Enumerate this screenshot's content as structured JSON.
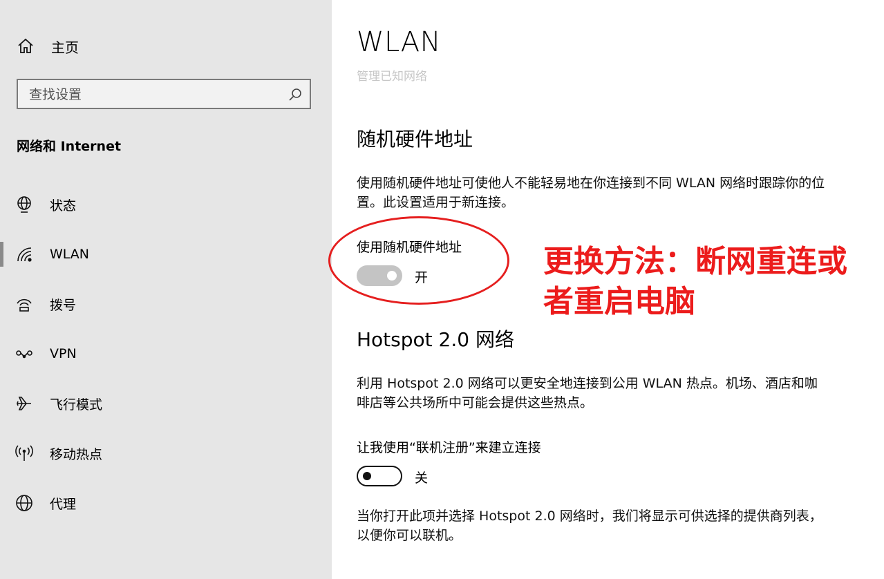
{
  "sidebar": {
    "home_label": "主页",
    "search_placeholder": "查找设置",
    "section_title": "网络和 Internet",
    "items": [
      {
        "label": "状态",
        "icon": "status-globe-icon"
      },
      {
        "label": "WLAN",
        "icon": "wifi-icon",
        "selected": true
      },
      {
        "label": "拨号",
        "icon": "dialup-icon"
      },
      {
        "label": "VPN",
        "icon": "vpn-icon"
      },
      {
        "label": "飞行模式",
        "icon": "airplane-icon"
      },
      {
        "label": "移动热点",
        "icon": "hotspot-icon"
      },
      {
        "label": "代理",
        "icon": "globe-icon"
      }
    ]
  },
  "main": {
    "title": "WLAN",
    "manage_link": "管理已知网络",
    "random_mac": {
      "heading": "随机硬件地址",
      "description": "使用随机硬件地址可使他人不能轻易地在你连接到不同 WLAN 网络时跟踪你的位置。此设置适用于新连接。",
      "toggle_label": "使用随机硬件地址",
      "toggle_on": true,
      "toggle_state": "开"
    },
    "hotspot": {
      "heading": "Hotspot 2.0 网络",
      "description": "利用 Hotspot 2.0 网络可以更安全地连接到公用 WLAN 热点。机场、酒店和咖啡店等公共场所中可能会提供这些热点。",
      "toggle_label": "让我使用“联机注册”来建立连接",
      "toggle_on": false,
      "toggle_state": "关",
      "footer": "当你打开此项并选择 Hotspot 2.0 网络时，我们将显示可供选择的提供商列表，以便你可以联机。"
    }
  },
  "annotation": {
    "text": "更换方法：断网重连或者重启电脑",
    "color": "#ec1c1c"
  }
}
